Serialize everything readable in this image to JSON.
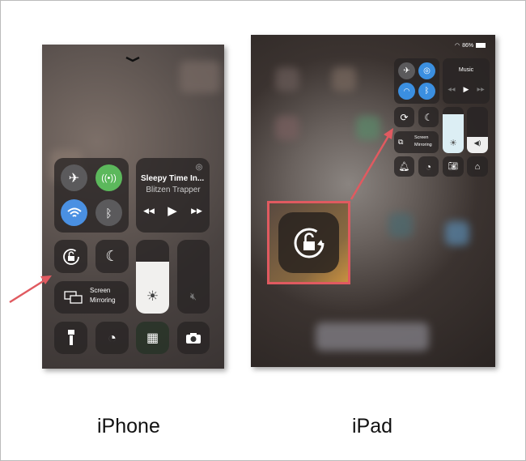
{
  "iphone": {
    "label": "iPhone",
    "now_playing": {
      "title": "Sleepy Time In...",
      "artist": "Blitzen Trapper"
    },
    "screen_mirroring": {
      "line1": "Screen",
      "line2": "Mirroring"
    },
    "brightness_level": 0.7,
    "volume_level": 0,
    "connectivity": {
      "airplane": false,
      "cellular": true,
      "wifi": true,
      "bluetooth": false
    },
    "colors": {
      "cellular": "#5cb85c",
      "wifi": "#4a90e2",
      "arrow": "#e05a60"
    }
  },
  "ipad": {
    "label": "iPad",
    "status": {
      "battery": "86%"
    },
    "now_playing": {
      "title": "Music"
    },
    "screen_mirroring": {
      "line1": "Screen",
      "line2": "Mirroring"
    },
    "brightness_level": 0.85,
    "volume_level": 0.35,
    "connectivity": {
      "airplane": false,
      "airdrop": true,
      "wifi": true,
      "bluetooth": true
    },
    "colors": {
      "active": "#3b8fe0",
      "highlight_box": "#e05a60"
    }
  }
}
